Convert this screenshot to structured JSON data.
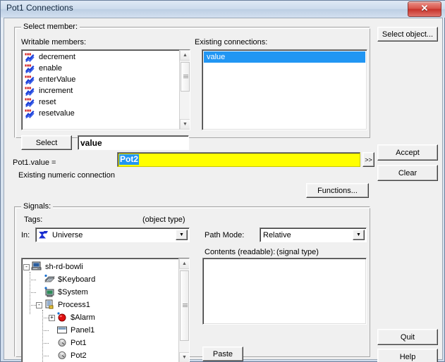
{
  "window": {
    "title": "Pot1 Connections",
    "close_label": "✕"
  },
  "select_member_group": {
    "legend": "Select member:",
    "writable_members_label": "Writable members:",
    "existing_connections_label": "Existing connections:",
    "writable_members": [
      {
        "label": "decrement",
        "icon": "method-icon"
      },
      {
        "label": "enable",
        "icon": "method-icon"
      },
      {
        "label": "enterValue",
        "icon": "method-icon"
      },
      {
        "label": "increment",
        "icon": "method-icon"
      },
      {
        "label": "reset",
        "icon": "method-icon"
      },
      {
        "label": "resetvalue",
        "icon": "method-icon"
      }
    ],
    "existing_connections": [
      {
        "label": "value",
        "selected": true
      }
    ],
    "select_button": "Select",
    "member_value": "value"
  },
  "right_buttons": {
    "select_object": "Select object...",
    "accept": "Accept",
    "clear": "Clear",
    "quit": "Quit",
    "help": "Help"
  },
  "expression": {
    "label": "Pot1.value =",
    "status": "Existing numeric connection",
    "value": "Pot2",
    "expand_button": ">>"
  },
  "functions_button": "Functions...",
  "signals_group": {
    "legend": "Signals:",
    "tags_label": "Tags:",
    "object_type_label": "(object type)",
    "in_label": "In:",
    "in_value": "Universe",
    "in_icon": "universe-arrow-icon",
    "path_mode_label": "Path Mode:",
    "path_mode_value": "Relative",
    "contents_label": "Contents (readable):",
    "signal_type_label": "(signal type)",
    "contents_items": [],
    "paste_button": "Paste",
    "tree": [
      {
        "label": "sh-rd-bowli",
        "icon": "computer-icon",
        "depth": 0,
        "expander": "-"
      },
      {
        "label": "$Keyboard",
        "icon": "keyboard-icon",
        "depth": 1,
        "expander": ""
      },
      {
        "label": "$System",
        "icon": "monitor-icon",
        "depth": 1,
        "expander": ""
      },
      {
        "label": "Process1",
        "icon": "document-icon",
        "depth": 1,
        "expander": "-"
      },
      {
        "label": "$Alarm",
        "icon": "alarm-icon",
        "depth": 2,
        "expander": "+"
      },
      {
        "label": "Panel1",
        "icon": "panel-icon",
        "depth": 2,
        "expander": ""
      },
      {
        "label": "Pot1",
        "icon": "pot-icon",
        "depth": 2,
        "expander": ""
      },
      {
        "label": "Pot2",
        "icon": "pot-icon",
        "depth": 2,
        "expander": ""
      }
    ]
  },
  "colors": {
    "selection_blue": "#2196f3",
    "expression_yellow": "#ffff00",
    "dialog_face": "#f0f0f0",
    "close_red": "#d9564c"
  }
}
